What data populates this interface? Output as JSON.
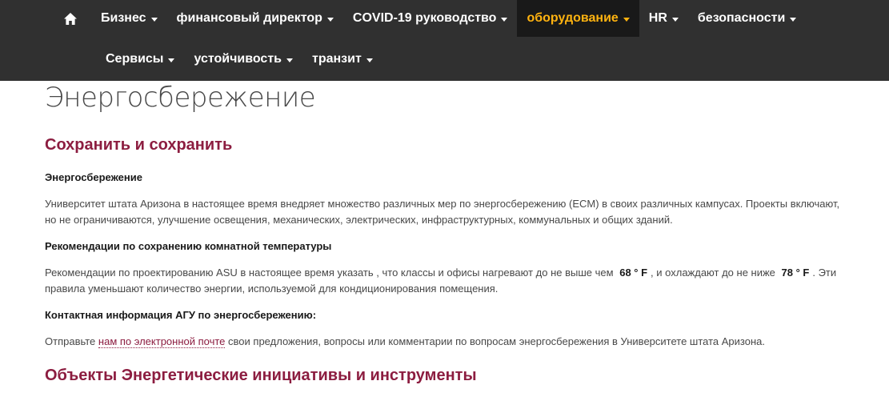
{
  "nav": {
    "row1": [
      {
        "label": "Бизнес"
      },
      {
        "label": "финансовый директор"
      },
      {
        "label": "COVID-19 руководство"
      },
      {
        "label": "оборудование"
      },
      {
        "label": "HR"
      },
      {
        "label": "безопасности"
      }
    ],
    "row2": [
      {
        "label": "Сервисы"
      },
      {
        "label": "устойчивость"
      },
      {
        "label": "транзит"
      }
    ],
    "active_index": 3,
    "colors": {
      "bar": "#303030",
      "active_bg": "#191919",
      "active_text": "#ffb310"
    }
  },
  "page": {
    "title": "Энергосбережение",
    "section1": {
      "heading": "Сохранить и сохранить",
      "sub1": "Энергосбережение",
      "p1": "Университет штата Аризона в настоящее время внедряет множество различных мер по энергосбережению (ECM) в своих различных кампусах. Проекты включают, но не ограничиваются, улучшение освещения, механических, электрических, инфраструктурных, коммунальных и общих зданий.",
      "sub2": "Рекомендации по сохранению комнатной температуры",
      "p2_a": "Рекомендации по проектированию ASU в настоящее время указать , что классы и офисы нагревают до не выше чем",
      "p2_heat": "68 ° F",
      "p2_b": ", и охлаждают до не ниже",
      "p2_cool": "78 ° F",
      "p2_c": ". Эти правила уменьшают количество энергии, используемой для кондиционирования помещения.",
      "sub3": "Контактная информация АГУ по энергосбережению:",
      "p3_a": "Отправьте",
      "p3_link": "нам по электронной почте",
      "p3_b": "свои предложения, вопросы или комментарии по вопросам энергосбережения в Университете штата Аризона."
    },
    "section2": {
      "heading": "Объекты Энергетические инициативы и инструменты"
    },
    "colors": {
      "maroon": "#8c1d40",
      "text": "#484848"
    }
  }
}
